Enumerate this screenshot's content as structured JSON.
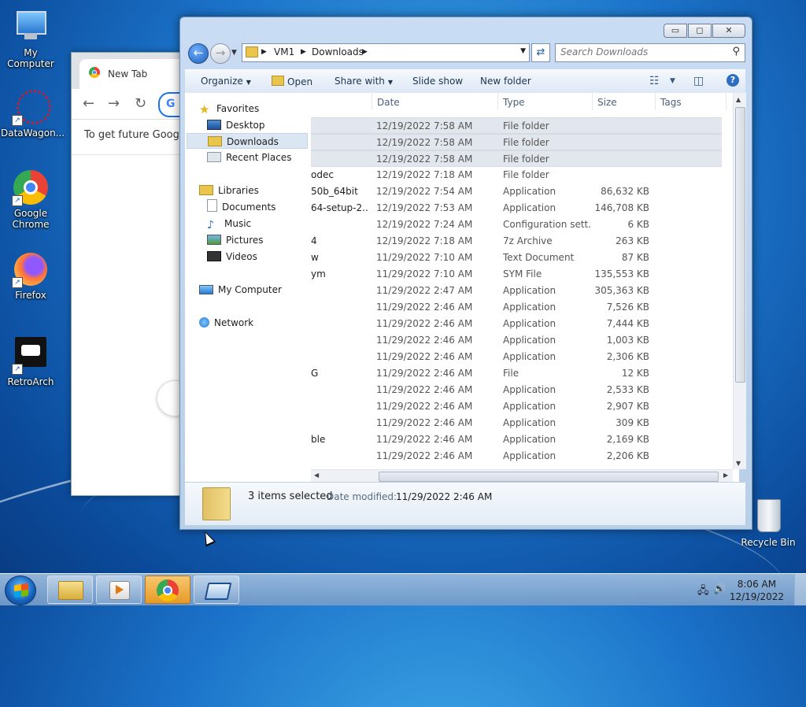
{
  "desktop": {
    "icons": [
      {
        "label": "My Computer"
      },
      {
        "label": "DataWagon..."
      },
      {
        "label": "Google Chrome"
      },
      {
        "label": "Firefox"
      },
      {
        "label": "RetroArch"
      }
    ],
    "recycle_bin": "Recycle Bin"
  },
  "chrome": {
    "tab_title": "New Tab",
    "info_text": "To get future Google"
  },
  "explorer": {
    "window_buttons": {
      "minimize": "▭",
      "maximize": "◻",
      "close": "✕"
    },
    "breadcrumb": [
      "VM1",
      "Downloads"
    ],
    "search_placeholder": "Search Downloads",
    "commands": {
      "organize": "Organize",
      "open": "Open",
      "share_with": "Share with",
      "slide_show": "Slide show",
      "new_folder": "New folder"
    },
    "nav": {
      "favorites": "Favorites",
      "desktop": "Desktop",
      "downloads": "Downloads",
      "recent_places": "Recent Places",
      "libraries": "Libraries",
      "documents": "Documents",
      "music": "Music",
      "pictures": "Pictures",
      "videos": "Videos",
      "my_computer": "My Computer",
      "network": "Network"
    },
    "columns": {
      "date": "Date",
      "type": "Type",
      "size": "Size",
      "tags": "Tags"
    },
    "rows": [
      {
        "name": "",
        "date": "12/19/2022 7:58 AM",
        "type": "File folder",
        "size": "",
        "selected": true
      },
      {
        "name": "",
        "date": "12/19/2022 7:58 AM",
        "type": "File folder",
        "size": "",
        "selected": true
      },
      {
        "name": "",
        "date": "12/19/2022 7:58 AM",
        "type": "File folder",
        "size": "",
        "selected": true
      },
      {
        "name": "odec",
        "date": "12/19/2022 7:18 AM",
        "type": "File folder",
        "size": ""
      },
      {
        "name": "50b_64bit",
        "date": "12/19/2022 7:54 AM",
        "type": "Application",
        "size": "86,632 KB"
      },
      {
        "name": "64-setup-2...",
        "date": "12/19/2022 7:53 AM",
        "type": "Application",
        "size": "146,708 KB"
      },
      {
        "name": "",
        "date": "12/19/2022 7:24 AM",
        "type": "Configuration sett...",
        "size": "6 KB"
      },
      {
        "name": "4",
        "date": "12/19/2022 7:18 AM",
        "type": "7z Archive",
        "size": "263 KB"
      },
      {
        "name": "w",
        "date": "11/29/2022 7:10 AM",
        "type": "Text Document",
        "size": "87 KB"
      },
      {
        "name": "ym",
        "date": "11/29/2022 7:10 AM",
        "type": "SYM File",
        "size": "135,553 KB"
      },
      {
        "name": "",
        "date": "11/29/2022 2:47 AM",
        "type": "Application",
        "size": "305,363 KB"
      },
      {
        "name": "",
        "date": "11/29/2022 2:46 AM",
        "type": "Application",
        "size": "7,526 KB"
      },
      {
        "name": "",
        "date": "11/29/2022 2:46 AM",
        "type": "Application",
        "size": "7,444 KB"
      },
      {
        "name": "",
        "date": "11/29/2022 2:46 AM",
        "type": "Application",
        "size": "1,003 KB"
      },
      {
        "name": "",
        "date": "11/29/2022 2:46 AM",
        "type": "Application",
        "size": "2,306 KB"
      },
      {
        "name": "G",
        "date": "11/29/2022 2:46 AM",
        "type": "File",
        "size": "12 KB"
      },
      {
        "name": "",
        "date": "11/29/2022 2:46 AM",
        "type": "Application",
        "size": "2,533 KB"
      },
      {
        "name": "",
        "date": "11/29/2022 2:46 AM",
        "type": "Application",
        "size": "2,907 KB"
      },
      {
        "name": "",
        "date": "11/29/2022 2:46 AM",
        "type": "Application",
        "size": "309 KB"
      },
      {
        "name": "ble",
        "date": "11/29/2022 2:46 AM",
        "type": "Application",
        "size": "2,169 KB"
      },
      {
        "name": "",
        "date": "11/29/2022 2:46 AM",
        "type": "Application",
        "size": "2,206 KB"
      }
    ],
    "details": {
      "count": "3 items selected",
      "date_label": "Date modified:",
      "date_value": "11/29/2022 2:46 AM"
    }
  },
  "taskbar": {
    "time": "8:06 AM",
    "date": "12/19/2022"
  }
}
